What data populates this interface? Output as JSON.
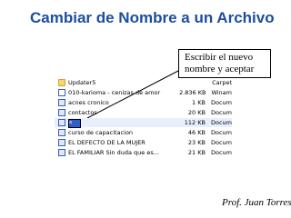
{
  "slide": {
    "title": "Cambiar de Nombre a un Archivo",
    "callout": {
      "line1": "Escribir el nuevo",
      "line2": "nombre y aceptar"
    },
    "author": "Prof. Juan Torres"
  },
  "explorer": {
    "folder_row": {
      "name": "Updater5",
      "size": "",
      "type": "Carpet",
      "icon": "folder-icon"
    },
    "files": [
      {
        "name": "010-karioma - cenizas de amor",
        "size": "2.836 KB",
        "type": "Winam",
        "icon": "audio-file-icon"
      },
      {
        "name": "acnes cronico",
        "size": "1 KB",
        "type": "Docum",
        "icon": "document-icon"
      },
      {
        "name": "contactos",
        "size": "20 KB",
        "type": "Docum",
        "icon": "document-icon"
      },
      {
        "name": "a",
        "size": "112 KB",
        "type": "Docum",
        "icon": "document-icon",
        "editing": true
      },
      {
        "name": "curso de capacitacion",
        "size": "46 KB",
        "type": "Docum",
        "icon": "document-icon"
      },
      {
        "name": "EL DEFECTO DE LA MUJER",
        "size": "23 KB",
        "type": "Docum",
        "icon": "document-icon"
      },
      {
        "name": "EL FAMILIAR Sin duda que es...",
        "size": "21 KB",
        "type": "Docum",
        "icon": "document-icon"
      }
    ]
  }
}
